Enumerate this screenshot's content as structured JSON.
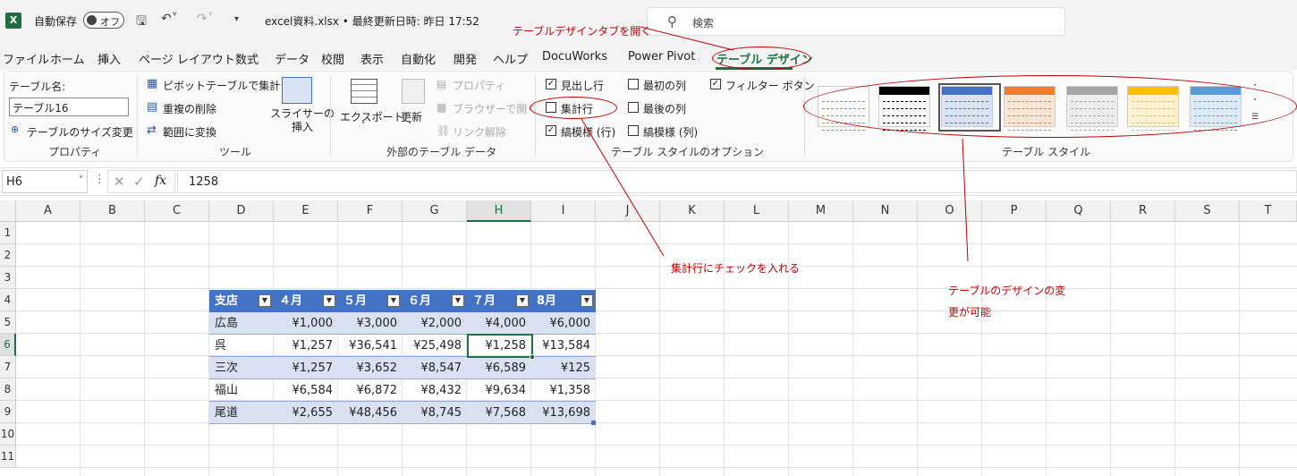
{
  "titlebar": {
    "logo": "X",
    "autosave_label": "自動保存",
    "autosave_toggle": "オフ",
    "filename": "excel資料.xlsx • 最終更新日時: 昨日 17:52",
    "search_placeholder": "検索",
    "icons": [
      "save-icon",
      "undo-icon",
      "redo-icon",
      "customize-icon"
    ]
  },
  "tabs": [
    {
      "label": "ファイル"
    },
    {
      "label": "ホーム"
    },
    {
      "label": "挿入"
    },
    {
      "label": "ページ レイアウト"
    },
    {
      "label": "数式"
    },
    {
      "label": "データ"
    },
    {
      "label": "校閲"
    },
    {
      "label": "表示"
    },
    {
      "label": "自動化"
    },
    {
      "label": "開発"
    },
    {
      "label": "ヘルプ"
    },
    {
      "label": "DocuWorks"
    },
    {
      "label": "Power Pivot"
    },
    {
      "label": "テーブル デザイン",
      "active": true
    }
  ],
  "ribbon": {
    "props": {
      "name_label": "テーブル名:",
      "name_value": "テーブル16",
      "resize": "テーブルのサイズ変更",
      "group": "プロパティ"
    },
    "tools": {
      "pivot": "ピボットテーブルで集計",
      "dedupe": "重複の削除",
      "convert": "範囲に変換",
      "slicer": "スライサーの\n挿入",
      "group": "ツール"
    },
    "external": {
      "export": "エクスポート",
      "refresh": "更新",
      "properties": "プロパティ",
      "browser": "ブラウザーで開く",
      "unlink": "リンク解除",
      "group": "外部のテーブル データ"
    },
    "options": {
      "header_row": {
        "label": "見出し行",
        "checked": true
      },
      "total_row": {
        "label": "集計行",
        "checked": false
      },
      "banded_rows": {
        "label": "縞模様 (行)",
        "checked": true
      },
      "first_col": {
        "label": "最初の列",
        "checked": false
      },
      "last_col": {
        "label": "最後の列",
        "checked": false
      },
      "banded_cols": {
        "label": "縞模様 (列)",
        "checked": false
      },
      "filter_btn": {
        "label": "フィルター ボタン",
        "checked": true
      },
      "group": "テーブル スタイルのオプション"
    },
    "styles": {
      "group": "テーブル スタイル",
      "swatches": [
        {
          "head": "#ffffff",
          "line": "#70ad47",
          "bg": "#ffffff"
        },
        {
          "head": "#000000",
          "line": "#000000",
          "bg": "#ffffff"
        },
        {
          "head": "#4472c4",
          "line": "#4472c4",
          "bg": "#dae3f3"
        },
        {
          "head": "#ed7d31",
          "line": "#ed7d31",
          "bg": "#fbe5d6"
        },
        {
          "head": "#a5a5a5",
          "line": "#a5a5a5",
          "bg": "#ededed"
        },
        {
          "head": "#ffc000",
          "line": "#ffc000",
          "bg": "#fff2cc"
        },
        {
          "head": "#5b9bd5",
          "line": "#5b9bd5",
          "bg": "#deebf7"
        }
      ]
    }
  },
  "formula_bar": {
    "name_box": "H6",
    "formula": "1258"
  },
  "columns": [
    "A",
    "B",
    "C",
    "D",
    "E",
    "F",
    "G",
    "H",
    "I",
    "J",
    "K",
    "L",
    "M",
    "N",
    "O",
    "P",
    "Q",
    "R",
    "S",
    "T"
  ],
  "rows": [
    "1",
    "2",
    "3",
    "4",
    "5",
    "6",
    "7",
    "8",
    "9",
    "10",
    "11"
  ],
  "selected_col": "H",
  "selected_row": "6",
  "table": {
    "headers": [
      "支店",
      "４月",
      "５月",
      "６月",
      "７月",
      "8月"
    ],
    "rows": [
      [
        "広島",
        "¥1,000",
        "¥3,000",
        "¥2,000",
        "¥4,000",
        "¥6,000"
      ],
      [
        "呉",
        "¥1,257",
        "¥36,541",
        "¥25,498",
        "¥1,258",
        "¥13,584"
      ],
      [
        "三次",
        "¥1,257",
        "¥3,652",
        "¥8,547",
        "¥6,589",
        "¥125"
      ],
      [
        "福山",
        "¥6,584",
        "¥6,872",
        "¥8,432",
        "¥9,634",
        "¥1,358"
      ],
      [
        "尾道",
        "¥2,655",
        "¥48,456",
        "¥8,745",
        "¥7,568",
        "¥13,698"
      ]
    ]
  },
  "annotations": {
    "open_tab": "テーブルデザインタブを開く",
    "check_total": "集計行にチェックを入れる",
    "design_change_1": "テーブルのデザインの変",
    "design_change_2": "更が可能"
  }
}
